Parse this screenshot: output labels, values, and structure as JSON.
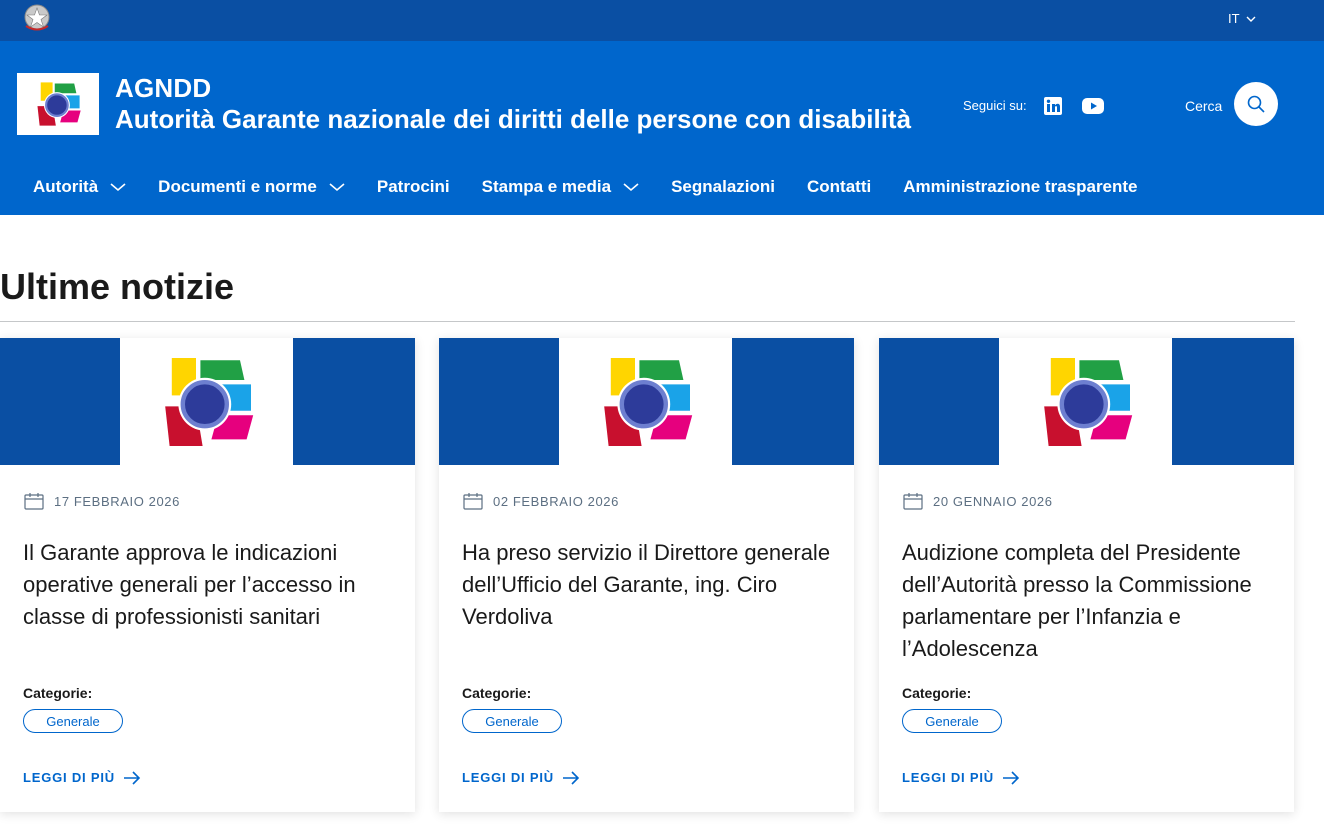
{
  "slim_header": {
    "language": "IT"
  },
  "header": {
    "acronym": "AGNDD",
    "name": "Autorità Garante nazionale dei diritti delle persone con disabilità",
    "social_label": "Seguici su:",
    "social_icons": [
      "linkedin-icon",
      "youtube-icon"
    ],
    "search_label": "Cerca"
  },
  "nav": {
    "items": [
      {
        "label": "Autorità",
        "has_dropdown": true
      },
      {
        "label": "Documenti e norme",
        "has_dropdown": true
      },
      {
        "label": "Patrocini",
        "has_dropdown": false
      },
      {
        "label": "Stampa e media",
        "has_dropdown": true
      },
      {
        "label": "Segnalazioni",
        "has_dropdown": false
      },
      {
        "label": "Contatti",
        "has_dropdown": false
      },
      {
        "label": "Amministrazione trasparente",
        "has_dropdown": false
      }
    ]
  },
  "news": {
    "section_title": "Ultime notizie",
    "cards": [
      {
        "date": "17 FEBBRAIO 2026",
        "title": "Il Garante approva le indicazioni operative generali per l’accesso in classe di professionisti sanitari",
        "category_label": "Categorie:",
        "category": "Generale",
        "read_more": "LEGGI DI PIÙ"
      },
      {
        "date": "02 FEBBRAIO 2026",
        "title": "Ha preso servizio il Direttore generale dell’Ufficio del Garante, ing. Ciro Verdoliva",
        "category_label": "Categorie:",
        "category": "Generale",
        "read_more": "LEGGI DI PIÙ"
      },
      {
        "date": "20 GENNAIO 2026",
        "title": "Audizione completa del Presidente dell’Autorità presso la Commissione parlamentare per l’Infanzia e l’Adolescenza",
        "category_label": "Categorie:",
        "category": "Generale",
        "read_more": "LEGGI DI PIÙ"
      }
    ]
  },
  "colors": {
    "primary": "#0066cc",
    "dark_blue": "#0a4fa3",
    "text": "#1a1a1a",
    "muted": "#5c6f82"
  }
}
